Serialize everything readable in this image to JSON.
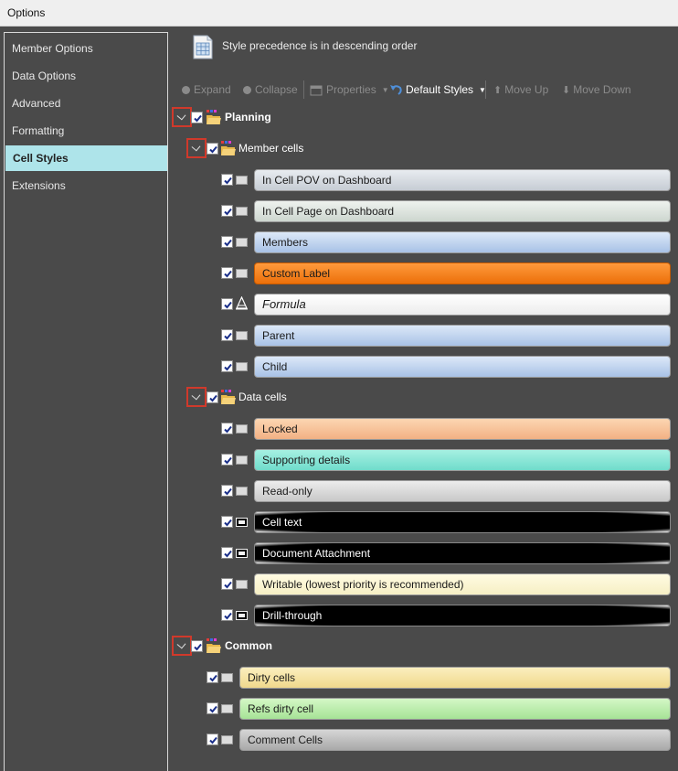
{
  "window": {
    "title": "Options"
  },
  "sidebar": {
    "items": [
      {
        "label": "Member Options"
      },
      {
        "label": "Data Options"
      },
      {
        "label": "Advanced"
      },
      {
        "label": "Formatting"
      },
      {
        "label": "Cell Styles",
        "active": true
      },
      {
        "label": "Extensions"
      }
    ]
  },
  "header": {
    "text": "Style precedence is in descending order"
  },
  "toolbar": {
    "expand": "Expand",
    "collapse": "Collapse",
    "properties": "Properties",
    "default_styles": "Default Styles",
    "move_up": "Move Up",
    "move_down": "Move Down"
  },
  "tree": {
    "planning": {
      "label": "Planning",
      "member_cells": {
        "label": "Member cells",
        "items": [
          {
            "label": "In Cell POV on Dashboard"
          },
          {
            "label": "In Cell Page on Dashboard"
          },
          {
            "label": "Members"
          },
          {
            "label": "Custom Label"
          },
          {
            "label": "Formula"
          },
          {
            "label": "Parent"
          },
          {
            "label": "Child"
          }
        ]
      },
      "data_cells": {
        "label": "Data cells",
        "items": [
          {
            "label": "Locked"
          },
          {
            "label": "Supporting details"
          },
          {
            "label": "Read-only"
          },
          {
            "label": "Cell text"
          },
          {
            "label": "Document Attachment"
          },
          {
            "label": "Writable (lowest priority is recommended)"
          },
          {
            "label": "Drill-through"
          }
        ]
      }
    },
    "common": {
      "label": "Common",
      "items": [
        {
          "label": "Dirty cells"
        },
        {
          "label": "Refs dirty cell"
        },
        {
          "label": "Comment Cells"
        }
      ]
    }
  },
  "colors": {
    "sidebar_active": "#aee4ea",
    "highlight_border": "#d0392b",
    "custom_label": "#f07c10"
  },
  "icons": {
    "header": "document-table-icon",
    "expand": "expand-icon",
    "collapse": "collapse-icon",
    "properties": "properties-icon",
    "default_styles": "undo-styles-icon",
    "move_up": "arrow-up-icon",
    "move_down": "arrow-down-icon",
    "group": "style-folder-icon"
  }
}
